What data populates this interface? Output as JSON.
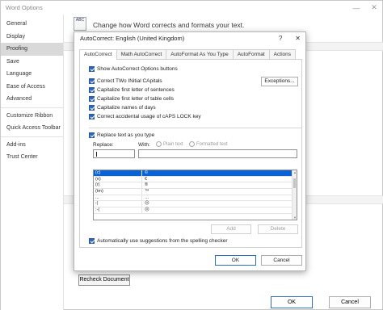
{
  "outer": {
    "title": "Word Options",
    "minimize": "—",
    "close": "✕",
    "heading": "Change how Word corrects and formats your text.",
    "abc_icon_text": "ABC",
    "nav": [
      {
        "label": "General"
      },
      {
        "label": "Display"
      },
      {
        "label": "Proofing",
        "active": true
      },
      {
        "label": "Save"
      },
      {
        "label": "Language"
      },
      {
        "label": "Ease of Access"
      },
      {
        "label": "Advanced"
      },
      {
        "label": "Customize Ribbon"
      },
      {
        "label": "Quick Access Toolbar"
      },
      {
        "label": "Add-ins"
      },
      {
        "label": "Trust Center"
      }
    ],
    "recheck_label": "Recheck Document",
    "ok_label": "OK",
    "cancel_label": "Cancel"
  },
  "dialog": {
    "title": "AutoCorrect: English (United Kingdom)",
    "help": "?",
    "close": "✕",
    "tabs": [
      {
        "label": "AutoCorrect",
        "active": true
      },
      {
        "label": "Math AutoCorrect"
      },
      {
        "label": "AutoFormat As You Type"
      },
      {
        "label": "AutoFormat"
      },
      {
        "label": "Actions"
      }
    ],
    "options": [
      {
        "label": "Show AutoCorrect Options buttons",
        "checked": true
      },
      {
        "label": "Correct TWo INitial CApitals",
        "checked": true
      },
      {
        "label": "Capitalize first letter of sentences",
        "checked": true
      },
      {
        "label": "Capitalize first letter of table cells",
        "checked": true
      },
      {
        "label": "Capitalize names of days",
        "checked": true
      },
      {
        "label": "Correct accidental usage of cAPS LOCK key",
        "checked": true
      }
    ],
    "exceptions_label": "Exceptions...",
    "replace_text_label": "Replace text as you type",
    "replace_label": "Replace:",
    "with_label": "With:",
    "plain_text_label": "Plain text",
    "formatted_text_label": "Formatted text",
    "replace_value": "",
    "with_value": "",
    "entries": [
      {
        "replace": "(c)",
        "with": "©",
        "selected": true
      },
      {
        "replace": "(e)",
        "with": "€"
      },
      {
        "replace": "(r)",
        "with": "®"
      },
      {
        "replace": "(tm)",
        "with": "™"
      },
      {
        "replace": "...",
        "with": "…"
      },
      {
        "replace": ":(",
        "with": "☹"
      },
      {
        "replace": ":-(",
        "with": "☹"
      }
    ],
    "add_label": "Add",
    "delete_label": "Delete",
    "spelling_label": "Automatically use suggestions from the spelling checker",
    "ok_label": "OK",
    "cancel_label": "Cancel"
  },
  "colors": {
    "accent": "#2d66b8",
    "selection": "#0a63d6",
    "nav_active": "#d9d9d9"
  }
}
